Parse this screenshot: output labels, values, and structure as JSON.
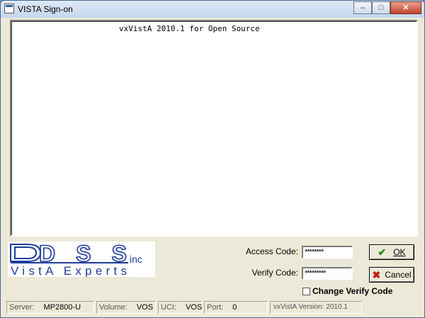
{
  "window": {
    "title": "VISTA Sign-on"
  },
  "console": {
    "banner": "vxVistA 2010.1 for Open Source"
  },
  "logo": {
    "line1": "DSS",
    "suffix": "inc",
    "line2": "VistA Experts"
  },
  "form": {
    "access_label": "Access Code:",
    "access_value": "********",
    "verify_label": "Verify Code:",
    "verify_value": "*********",
    "change_verify_label": "Change Verify Code",
    "change_verify_checked": false
  },
  "buttons": {
    "ok_label": "OK",
    "cancel_label": "Cancel"
  },
  "status": {
    "server_label": "Server:",
    "server_value": "MP2800-U",
    "volume_label": "Volume:",
    "volume_value": "VOS",
    "uci_label": "UCI:",
    "uci_value": "VOS",
    "port_label": "Port:",
    "port_value": "0",
    "version_text": "vxVistA Version: 2010.1"
  },
  "icons": {
    "app": "vista-app-icon",
    "ok": "checkmark-icon",
    "cancel": "x-icon"
  },
  "colors": {
    "logo_blue": "#1f3c9b",
    "ok_green": "#1b8a1b",
    "cancel_red": "#c41a1a"
  }
}
